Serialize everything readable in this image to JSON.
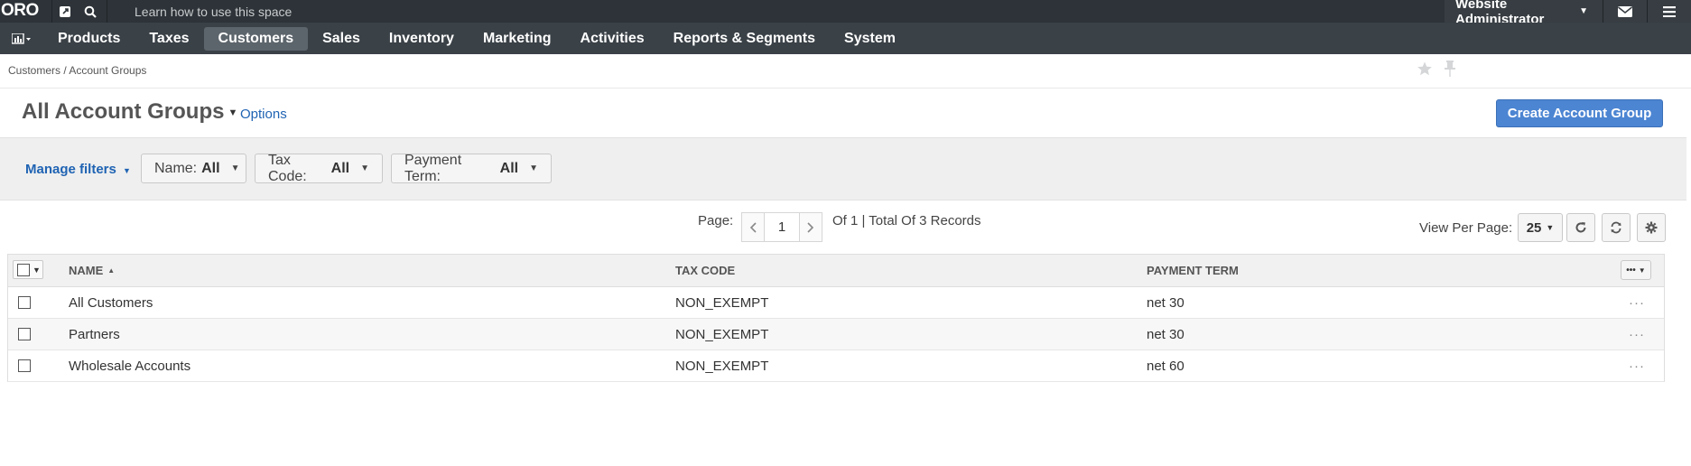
{
  "topbar": {
    "logo": "ORO",
    "learn_text": "Learn how to use this space",
    "user_label": "Website Administrator"
  },
  "main_nav": {
    "items": [
      {
        "label": "Products",
        "active": false
      },
      {
        "label": "Taxes",
        "active": false
      },
      {
        "label": "Customers",
        "active": true
      },
      {
        "label": "Sales",
        "active": false
      },
      {
        "label": "Inventory",
        "active": false
      },
      {
        "label": "Marketing",
        "active": false
      },
      {
        "label": "Activities",
        "active": false
      },
      {
        "label": "Reports & Segments",
        "active": false
      },
      {
        "label": "System",
        "active": false
      }
    ]
  },
  "breadcrumb": "Customers / Account Groups",
  "page": {
    "title": "All Account Groups",
    "options_label": "Options",
    "create_button": "Create Account Group"
  },
  "filters": {
    "manage_label": "Manage filters",
    "items": [
      {
        "name": "Name:",
        "value": "All"
      },
      {
        "name": "Tax Code:",
        "value": "All"
      },
      {
        "name": "Payment Term:",
        "value": "All"
      }
    ]
  },
  "pager": {
    "page_label": "Page:",
    "current_page": "1",
    "summary": "Of 1 | Total Of 3 Records",
    "per_page_label": "View Per Page:",
    "per_page_value": "25"
  },
  "grid": {
    "columns": [
      "NAME",
      "TAX CODE",
      "PAYMENT TERM"
    ],
    "rows": [
      {
        "name": "All Customers",
        "tax_code": "NON_EXEMPT",
        "payment_term": "net 30"
      },
      {
        "name": "Partners",
        "tax_code": "NON_EXEMPT",
        "payment_term": "net 30"
      },
      {
        "name": "Wholesale Accounts",
        "tax_code": "NON_EXEMPT",
        "payment_term": "net 60"
      }
    ],
    "row_action_glyph": "···"
  },
  "icons": {
    "topbar": [
      "external-link-icon",
      "search-icon",
      "envelope-icon",
      "hamburger-menu-icon"
    ],
    "page": [
      "star-icon",
      "pin-icon"
    ],
    "grid_tools": [
      "refresh-icon",
      "reset-icon",
      "settings-gear-icon"
    ]
  },
  "colors": {
    "topbar_bg": "#2d3338",
    "nav_bg": "#3a4147",
    "accent_blue": "#4c85d2",
    "link_blue": "#1f63b3"
  }
}
